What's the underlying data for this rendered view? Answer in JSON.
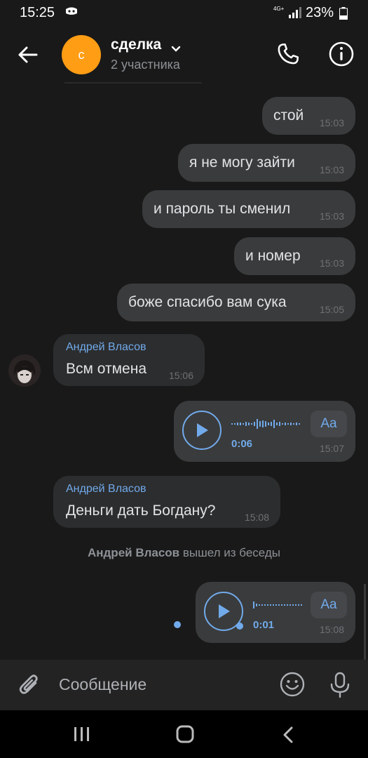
{
  "status": {
    "time": "15:25",
    "network": "4G+",
    "battery": "23%"
  },
  "header": {
    "title": "сделка",
    "subtitle": "2 участника",
    "avatar_letter": "с"
  },
  "messages": [
    {
      "text": "стой",
      "time": "15:03"
    },
    {
      "text": "я не могу зайти",
      "time": "15:03"
    },
    {
      "text": "и пароль ты сменил",
      "time": "15:03"
    },
    {
      "text": "и номер",
      "time": "15:03"
    },
    {
      "text": "боже спасибо вам сука",
      "time": "15:05"
    }
  ],
  "incoming": [
    {
      "author": "Андрей Власов",
      "text": "Всм отмена",
      "time": "15:06"
    },
    {
      "author": "Андрей Власов",
      "text": "Деньги дать Богдану?",
      "time": "15:08"
    }
  ],
  "voice": [
    {
      "duration": "0:06",
      "time": "15:07",
      "transcribe_label": "Aa"
    },
    {
      "duration": "0:01",
      "time": "15:08",
      "transcribe_label": "Aa"
    }
  ],
  "system": {
    "name": "Андрей Власов",
    "action": " вышел из беседы"
  },
  "composer": {
    "placeholder": "Сообщение"
  },
  "colors": {
    "accent": "#71aaeb",
    "avatar": "#ff9d14",
    "bubble_out": "#3a3b3c",
    "bubble_in": "#2c2d2e"
  },
  "icons": [
    "back-arrow-icon",
    "chevron-down-icon",
    "phone-icon",
    "info-icon",
    "play-icon",
    "paperclip-icon",
    "emoji-icon",
    "microphone-icon",
    "recent-apps-icon",
    "home-icon",
    "nav-back-icon"
  ]
}
